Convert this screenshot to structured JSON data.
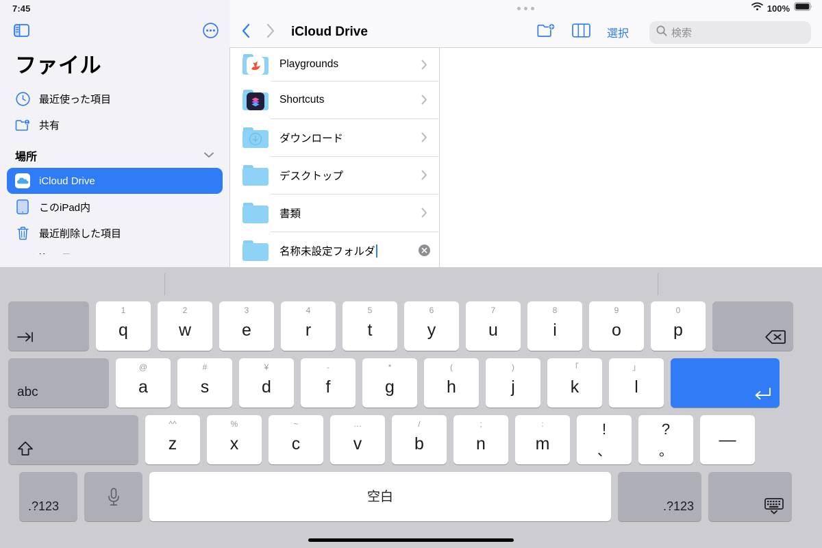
{
  "status_bar": {
    "time": "7:45",
    "battery_percent": "100%",
    "wifi_icon": "wifi-icon",
    "battery_icon": "battery-full-icon"
  },
  "sidebar": {
    "toggle_icon": "sidebar-toggle-icon",
    "more_icon": "more-circle-icon",
    "title": "ファイル",
    "quick_items": [
      {
        "label": "最近使った項目",
        "icon": "clock-icon"
      },
      {
        "label": "共有",
        "icon": "shared-folder-icon"
      }
    ],
    "section": {
      "title": "場所",
      "collapse_icon": "chevron-down-icon"
    },
    "locations": [
      {
        "label": "iCloud Drive",
        "icon": "icloud-icon",
        "selected": true
      },
      {
        "label": "このiPad内",
        "icon": "ipad-icon",
        "selected": false
      },
      {
        "label": "最近削除した項目",
        "icon": "trash-icon",
        "selected": false
      }
    ],
    "cut_off_section": "よく使う項目"
  },
  "navbar": {
    "back_icon": "chevron-left-icon",
    "forward_icon": "chevron-right-icon",
    "title": "iCloud Drive",
    "new_folder_icon": "new-folder-icon",
    "view_columns_icon": "column-view-icon",
    "select_label": "選択",
    "search": {
      "icon": "search-icon",
      "placeholder": "検索",
      "value": ""
    },
    "grabber_icon": "window-grabber-dots"
  },
  "file_list": [
    {
      "name": "Playgrounds",
      "icon": "swift-playgrounds-folder-icon",
      "trailing": "chevron-right-icon",
      "editing": false
    },
    {
      "name": "Shortcuts",
      "icon": "shortcuts-folder-icon",
      "trailing": "chevron-right-icon",
      "editing": false
    },
    {
      "name": "ダウンロード",
      "icon": "downloads-folder-icon",
      "trailing": "chevron-right-icon",
      "editing": false
    },
    {
      "name": "デスクトップ",
      "icon": "folder-icon",
      "trailing": "chevron-right-icon",
      "editing": false
    },
    {
      "name": "書類",
      "icon": "folder-icon",
      "trailing": "chevron-right-icon",
      "editing": false
    },
    {
      "name": "名称未設定フォルダ",
      "icon": "folder-icon",
      "trailing": "clear-text-icon",
      "editing": true
    }
  ],
  "keyboard": {
    "row1": [
      {
        "main": "",
        "hint": "",
        "type": "tab",
        "icon": "tab-icon",
        "name": "tab-key"
      },
      {
        "main": "q",
        "hint": "1",
        "type": "letter"
      },
      {
        "main": "w",
        "hint": "2",
        "type": "letter"
      },
      {
        "main": "e",
        "hint": "3",
        "type": "letter"
      },
      {
        "main": "r",
        "hint": "4",
        "type": "letter"
      },
      {
        "main": "t",
        "hint": "5",
        "type": "letter"
      },
      {
        "main": "y",
        "hint": "6",
        "type": "letter"
      },
      {
        "main": "u",
        "hint": "7",
        "type": "letter"
      },
      {
        "main": "i",
        "hint": "8",
        "type": "letter"
      },
      {
        "main": "o",
        "hint": "9",
        "type": "letter"
      },
      {
        "main": "p",
        "hint": "0",
        "type": "letter"
      },
      {
        "main": "",
        "hint": "",
        "type": "backspace",
        "icon": "delete-backward-icon",
        "name": "backspace-key"
      }
    ],
    "row2": [
      {
        "main": "abc",
        "hint": "",
        "type": "abc",
        "name": "abc-key"
      },
      {
        "main": "a",
        "hint": "@",
        "type": "letter"
      },
      {
        "main": "s",
        "hint": "#",
        "type": "letter"
      },
      {
        "main": "d",
        "hint": "¥",
        "type": "letter"
      },
      {
        "main": "f",
        "hint": "-",
        "type": "letter"
      },
      {
        "main": "g",
        "hint": "*",
        "type": "letter"
      },
      {
        "main": "h",
        "hint": "(",
        "type": "letter"
      },
      {
        "main": "j",
        "hint": ")",
        "type": "letter"
      },
      {
        "main": "k",
        "hint": "「",
        "type": "letter"
      },
      {
        "main": "l",
        "hint": "」",
        "type": "letter"
      },
      {
        "main": "",
        "hint": "",
        "type": "return",
        "icon": "return-icon",
        "name": "return-key"
      }
    ],
    "row3": [
      {
        "main": "",
        "hint": "",
        "type": "shift",
        "icon": "shift-icon",
        "name": "shift-key"
      },
      {
        "main": "z",
        "hint": "^^",
        "type": "letter"
      },
      {
        "main": "x",
        "hint": "%",
        "type": "letter"
      },
      {
        "main": "c",
        "hint": "~",
        "type": "letter"
      },
      {
        "main": "v",
        "hint": "…",
        "type": "letter"
      },
      {
        "main": "b",
        "hint": "/",
        "type": "letter"
      },
      {
        "main": "n",
        "hint": ";",
        "type": "letter"
      },
      {
        "main": "m",
        "hint": ":",
        "type": "letter"
      },
      {
        "top": "!",
        "bottom": "、",
        "type": "dual"
      },
      {
        "top": "?",
        "bottom": "。",
        "type": "dual"
      },
      {
        "main": "—",
        "hint": "",
        "type": "dash"
      }
    ],
    "row4": [
      {
        "main": ".?123",
        "type": "num-left",
        "name": "numbers-key-left"
      },
      {
        "main": "",
        "type": "mic",
        "icon": "microphone-icon",
        "name": "dictation-key"
      },
      {
        "main": "空白",
        "type": "space",
        "name": "space-key"
      },
      {
        "main": ".?123",
        "type": "num-right",
        "name": "numbers-key-right"
      },
      {
        "main": "",
        "type": "dismiss",
        "icon": "keyboard-dismiss-icon",
        "name": "dismiss-keyboard-key"
      }
    ]
  },
  "colors": {
    "accent": "#2f7cf6",
    "sidebar_bg": "#f2f2f7",
    "keyboard_bg": "#ccccd1",
    "key_dark": "#aeaeb6",
    "folder_blue": "#8ed2f5"
  }
}
